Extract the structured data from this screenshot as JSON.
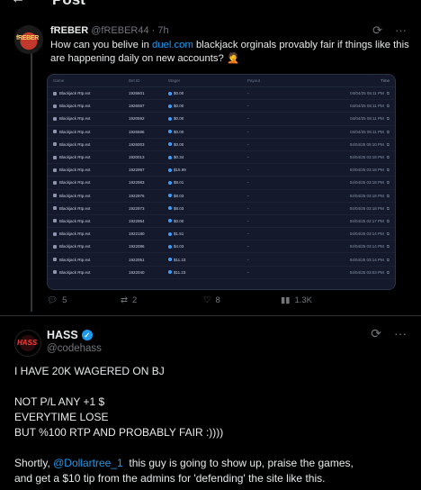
{
  "header": {
    "back_icon": "back-arrow-icon",
    "title": "Post"
  },
  "parent_tweet": {
    "avatar_text": "fREBER",
    "name": "fREBER",
    "handle": "@fREBER44",
    "time": "· 7h",
    "text_before": "How can you belive in ",
    "link": "duel.com",
    "text_after": " blackjack orginals provably fair if things like this are happening daily on new accounts? 🤦",
    "table": {
      "headers": [
        "Game",
        "Bet ID",
        "Wager",
        "Payout",
        "Time"
      ],
      "rows": [
        {
          "game": "Blackjack Rtp.ext",
          "id": "1926601",
          "wager": "$0.00",
          "payout": "-",
          "time": "04/04/25 05:11 PM"
        },
        {
          "game": "Blackjack Rtp.ext",
          "id": "1926597",
          "wager": "$0.00",
          "payout": "-",
          "time": "04/04/25 05:11 PM"
        },
        {
          "game": "Blackjack Rtp.ext",
          "id": "1920592",
          "wager": "$0.00",
          "payout": "-",
          "time": "04/04/25 05:11 PM"
        },
        {
          "game": "Blackjack Rtp.ext",
          "id": "1926586",
          "wager": "$0.00",
          "payout": "-",
          "time": "04/04/25 05:11 PM"
        },
        {
          "game": "Blackjack Rtp.ext",
          "id": "1926003",
          "wager": "$0.00",
          "payout": "-",
          "time": "04/04/25 05:10 PM"
        },
        {
          "game": "Blackjack Rtp.ext",
          "id": "1920013",
          "wager": "$0.34",
          "payout": "-",
          "time": "04/04/25 03:18 PM"
        },
        {
          "game": "Blackjack Rtp.ext",
          "id": "1922997",
          "wager": "$15.99",
          "payout": "-",
          "time": "04/04/25 03:18 PM"
        },
        {
          "game": "Blackjack Rtp.ext",
          "id": "1922983",
          "wager": "$8.01",
          "payout": "-",
          "time": "04/04/25 03:18 PM"
        },
        {
          "game": "Blackjack Rtp.ext",
          "id": "1922976",
          "wager": "$8.03",
          "payout": "-",
          "time": "04/04/25 03:18 PM"
        },
        {
          "game": "Blackjack Rtp.ext",
          "id": "1922973",
          "wager": "$8.03",
          "payout": "-",
          "time": "04/04/25 03:18 PM"
        },
        {
          "game": "Blackjack Rtp.ext",
          "id": "1922954",
          "wager": "$0.00",
          "payout": "-",
          "time": "04/04/25 02:17 PM"
        },
        {
          "game": "Blackjack Rtp.ext",
          "id": "1922180",
          "wager": "$1.51",
          "payout": "-",
          "time": "04/04/25 03:14 PM"
        },
        {
          "game": "Blackjack Rtp.ext",
          "id": "1922086",
          "wager": "$4.03",
          "payout": "-",
          "time": "04/04/25 03:14 PM"
        },
        {
          "game": "Blackjack Rtp.ext",
          "id": "1922051",
          "wager": "$11.23",
          "payout": "-",
          "time": "04/04/25 03:14 PM"
        },
        {
          "game": "Blackjack Rtp.ext",
          "id": "1922040",
          "wager": "$11.23",
          "payout": "-",
          "time": "04/04/25 03:03 PM"
        }
      ]
    },
    "actions": {
      "replies": "5",
      "reposts": "2",
      "likes": "8",
      "views": "1.3K"
    }
  },
  "main_tweet": {
    "avatar_text": "HASS",
    "name": "HASS",
    "handle": "@codehass",
    "line1": "I HAVE 20K WAGERED ON BJ",
    "line2": "NOT P/L ANY +1 $",
    "line3": "EVERYTIME LOSE",
    "line4": "BUT %100 RTP AND PROBABLY FAIR :))))",
    "line5_before": "Shortly, ",
    "line5_mention": "@Dollartree_1",
    "line5_after": "  this guy is going to show up, praise the games,",
    "line6": "and get a $10 tip from the admins for 'defending' the site like this."
  },
  "colors": {
    "accent": "#1d9bf0",
    "muted": "#71767b",
    "background": "#000000"
  }
}
